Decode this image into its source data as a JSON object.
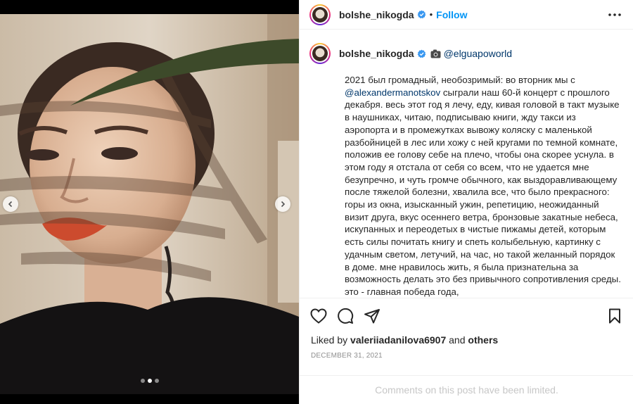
{
  "post": {
    "username": "bolshe_nikogda",
    "follow_label": "Follow",
    "separator": "•",
    "mention_top": "@elguapoworld",
    "caption_line1_pre": "2021 был громадный, необозримый: во вторник мы с ",
    "caption_mention": "@alexandermanotskov",
    "caption_rest": " сыграли наш 60-й концерт с прошлого декабря. весь этот год я лечу, еду, кивая головой в такт музыке в наушниках, читаю, подписываю книги, жду такси из аэропорта и в промежутках вывожу коляску с маленькой разбойницей в лес или хожу с ней кругами по темной комнате, положив ее голову себе на плечо, чтобы она скорее уснула. в этом году я отстала от себя со всем, что не удается мне безупречно, и чуть громче обычного, как выздоравливающему после тяжелой болезни, хвалила все, что было прекрасного: горы из окна, изысканный ужин, репетицию, неожиданный визит друга, вкус осеннего ветра, бронзовые закатные небеса, искупанных и переодетых в чистые пижамы детей, которым есть силы почитать книгу и спеть колыбельную, картинку с удачным светом, летучий, на час, но такой желанный порядок в доме. мне нравилось жить, я была признательна за возможность делать это без привычного сопротивления среды. это - главная победа года,",
    "likes_prefix": "Liked by",
    "liked_by_user": "valeriiadanilova6907",
    "likes_and": "and",
    "likes_others": "others",
    "date": "DECEMBER 31, 2021",
    "comments_limited": "Comments on this post have been limited."
  },
  "carousel": {
    "slide_count": 3,
    "active_index": 1
  },
  "icons": {
    "header": [
      "verified-badge-icon",
      "more-options-icon"
    ],
    "caption": [
      "camera-emoji-icon"
    ],
    "actions": [
      "heart-icon",
      "comment-icon",
      "share-icon",
      "bookmark-icon"
    ],
    "media": [
      "chevron-left-icon",
      "chevron-right-icon"
    ]
  },
  "colors": {
    "link": "#0095f6",
    "mention": "#00376b",
    "text": "#262626",
    "muted": "#8e8e8e",
    "verified": "#3897f0"
  }
}
